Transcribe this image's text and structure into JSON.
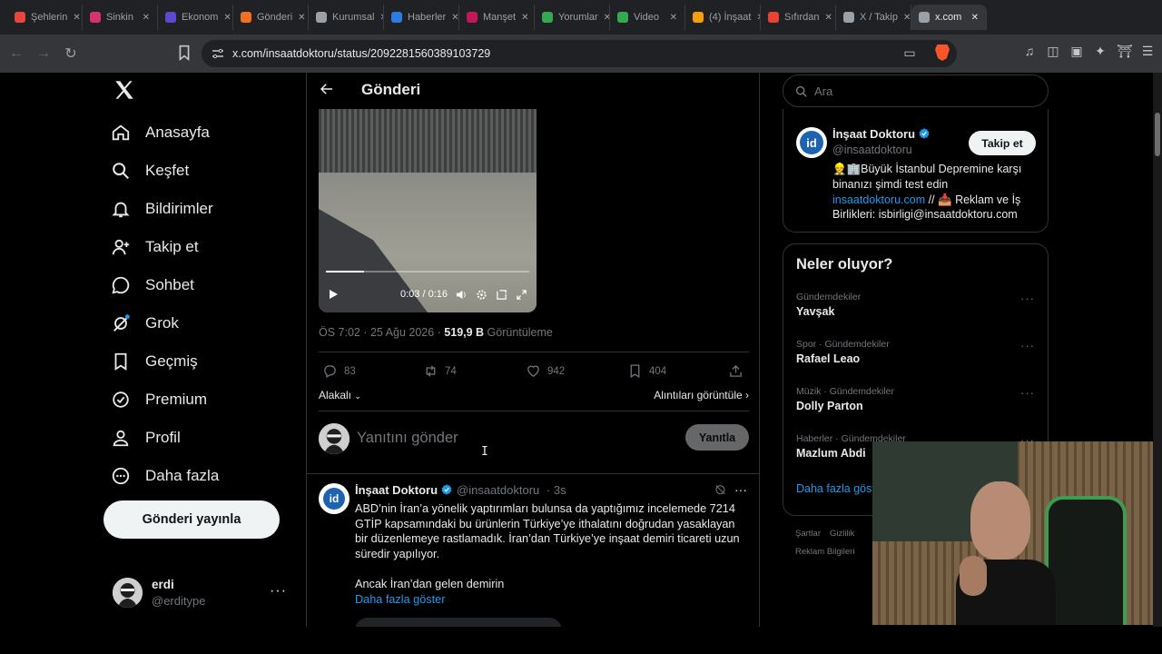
{
  "browser": {
    "tabs": [
      {
        "label": "Şehlerin",
        "color": "#e8453c"
      },
      {
        "label": "Sinkin",
        "color": "#d6336c"
      },
      {
        "label": "Ekonom",
        "color": "#5b4ad1"
      },
      {
        "label": "Gönderi",
        "color": "#f36f21"
      },
      {
        "label": "Kurumsal",
        "color": "#9aa0a6"
      },
      {
        "label": "Haberler",
        "color": "#2a7de1"
      },
      {
        "label": "Manşet",
        "color": "#c2185b"
      },
      {
        "label": "Yorumlar",
        "color": "#34a853"
      },
      {
        "label": "Video",
        "color": "#34a853"
      },
      {
        "label": "(4) İnşaat",
        "color": "#f59e0b"
      },
      {
        "label": "Sıfırdan",
        "color": "#ea4335"
      },
      {
        "label": "X / Takip",
        "color": "#9aa0a6"
      },
      {
        "label": "x.com",
        "color": "#9aa0a6"
      }
    ],
    "url": "x.com/insaatdoktoru/status/2092281560389103729"
  },
  "nav": {
    "items": [
      {
        "label": "Anasayfa",
        "icon": "home-icon"
      },
      {
        "label": "Keşfet",
        "icon": "search-icon"
      },
      {
        "label": "Bildirimler",
        "icon": "bell-icon"
      },
      {
        "label": "Takip et",
        "icon": "add-user-icon"
      },
      {
        "label": "Sohbet",
        "icon": "chat-icon"
      },
      {
        "label": "Grok",
        "icon": "grok-icon"
      },
      {
        "label": "Geçmiş",
        "icon": "bookmark-icon"
      },
      {
        "label": "Premium",
        "icon": "premium-icon"
      },
      {
        "label": "Profil",
        "icon": "profile-icon"
      },
      {
        "label": "Daha fazla",
        "icon": "more-circle-icon"
      }
    ],
    "post_button": "Gönderi yayınla",
    "user": {
      "name": "erdi",
      "handle": "@erditype"
    }
  },
  "post": {
    "header_title": "Gönderi",
    "video": {
      "time": "0:03 / 0:16",
      "progress": 0.1875
    },
    "meta": {
      "datetime": "ÖS 7:02 · 25 Ağu 2026 · ",
      "views_count": "519,9 B",
      "views_label": " Görüntüleme"
    },
    "actions": {
      "replies": "83",
      "reposts": "74",
      "likes": "942",
      "bookmarks": "404"
    },
    "sort_label": "Alakalı",
    "quotes_label": "Alıntıları görüntüle",
    "compose_placeholder": "Yanıtını gönder",
    "reply_button": "Yanıtla"
  },
  "reply_tweet": {
    "author": "İnşaat Doktoru",
    "handle": "@insaatdoktoru",
    "time": "· 3s",
    "avatar_text": "id",
    "paragraph1": "ABD’nin İran’a yönelik yaptırımları bulunsa da yaptığımız incelemede 7214 GTİP kapsamındaki bu ürünlerin Türkiye’ye ithalatını doğrudan yasaklayan bir düzenlemeye rastlamadık. İran’dan Türkiye’ye inşaat demiri ticareti uzun süredir yapılıyor.",
    "paragraph2": "Ancak İran’dan gelen demirin",
    "show_more": "Daha fazla göster"
  },
  "sidebar": {
    "search_placeholder": "Ara",
    "profile": {
      "name": "İnşaat Doktoru",
      "handle": "@insaatdoktoru",
      "follow_label": "Takip et",
      "avatar_text": "id",
      "bio_part1": "👷🏢Büyük İstanbul Depremine karşı binanızı şimdi test edin",
      "bio_link": "insaatdoktoru.com",
      "bio_part2": " // 📥 Reklam ve İş Birlikleri: isbirligi@insaatdoktoru.com"
    },
    "trends_title": "Neler oluyor?",
    "trends": [
      {
        "category": "Gündemdekiler",
        "title": "Yavşak"
      },
      {
        "category": "Spor · Gündemdekiler",
        "title": "Rafael Leao"
      },
      {
        "category": "Müzik · Gündemdekiler",
        "title": "Dolly Parton"
      },
      {
        "category": "Haberler · Gündemdekiler",
        "title": "Mazlum Abdi"
      }
    ],
    "show_more": "Daha fazla göster",
    "footer": [
      "Şartlar",
      "Gizlilik",
      "Reklam Bilgileri"
    ]
  },
  "colors": {
    "accent": "#1d9bf0",
    "background": "#000000",
    "border": "#2f3336",
    "muted": "#71767b"
  }
}
